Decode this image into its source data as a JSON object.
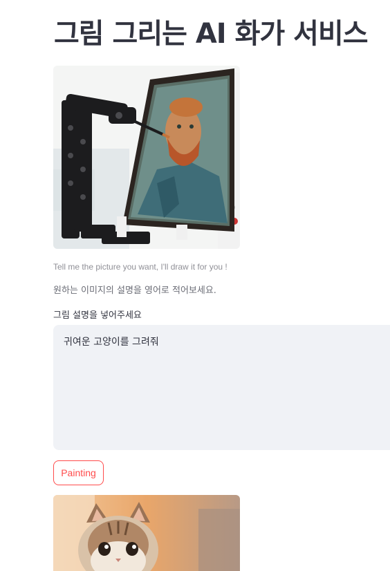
{
  "page": {
    "title": "그림 그리는 AI 화가 서비스"
  },
  "hero_image": {
    "icon": "robot-painting-van-gogh-image"
  },
  "caption": "Tell me the picture you want, I'll draw it for you !",
  "guide_text": "원하는 이미지의 설명을 영어로 적어보세요.",
  "prompt_field": {
    "label": "그림 설명을 넣어주세요",
    "value": "귀여운 고양이를 그려줘"
  },
  "paint_button": {
    "label": "Painting"
  },
  "result_image": {
    "icon": "generated-cat-image"
  },
  "colors": {
    "accent": "#ff4b4b",
    "text": "#31333f",
    "input_bg": "#f0f2f6"
  }
}
